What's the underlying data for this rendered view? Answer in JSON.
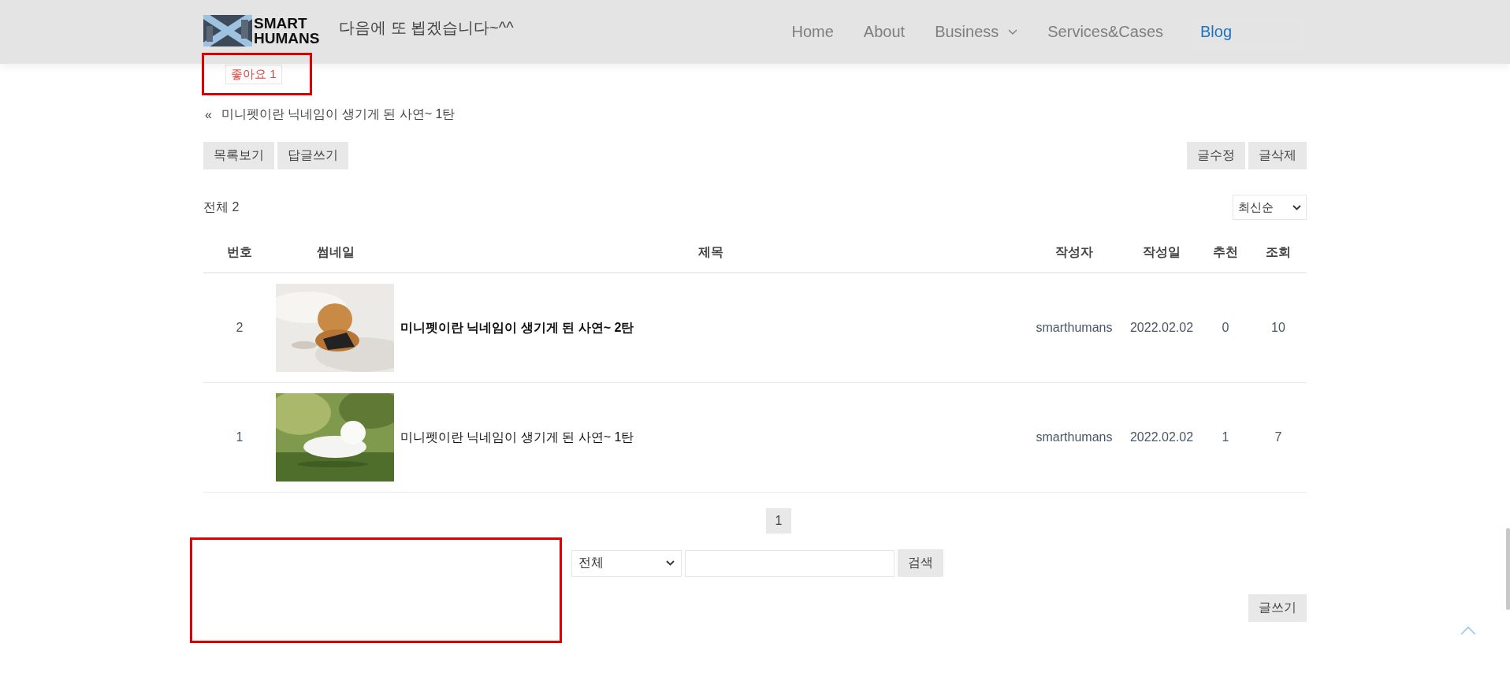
{
  "nav": {
    "logo": [
      "SMART",
      "HUMANS"
    ],
    "items": [
      {
        "label": "Home",
        "selected": false,
        "has_dropdown": false
      },
      {
        "label": "About",
        "selected": false,
        "has_dropdown": false
      },
      {
        "label": "Business",
        "selected": false,
        "has_dropdown": true
      },
      {
        "label": "Services&Cases",
        "selected": false,
        "has_dropdown": false
      },
      {
        "label": "Blog",
        "selected": true,
        "has_dropdown": false
      }
    ]
  },
  "post": {
    "closing_text": "다음에 또 뵙겠습니다~^^",
    "like_button": "좋아요 1",
    "prev_post": {
      "marker": "«",
      "title": "미니펫이란 닉네임이 생기게 된 사연~ 1탄"
    }
  },
  "actions": {
    "left": [
      "목록보기",
      "답글쓰기"
    ],
    "right": [
      "글수정",
      "글삭제"
    ]
  },
  "list": {
    "total": "전체 2",
    "sort": "최신순",
    "columns": [
      "번호",
      "썸네일",
      "제목",
      "작성자",
      "작성일",
      "추천",
      "조회"
    ],
    "rows": [
      {
        "number": "2",
        "title": "미니펫이란 닉네임이 생기게 된 사연~ 2탄",
        "bold": true,
        "author": "smarthumans",
        "date": "2022.02.02",
        "likes": "0",
        "views": "10"
      },
      {
        "number": "1",
        "title": "미니펫이란 닉네임이 생기게 된 사연~ 1탄",
        "bold": false,
        "author": "smarthumans",
        "date": "2022.02.02",
        "likes": "1",
        "views": "7"
      }
    ]
  },
  "pagination": [
    {
      "label": "1",
      "selected": true
    }
  ],
  "search": {
    "field": "전체",
    "button": "검색"
  },
  "write_button": "글쓰기"
}
